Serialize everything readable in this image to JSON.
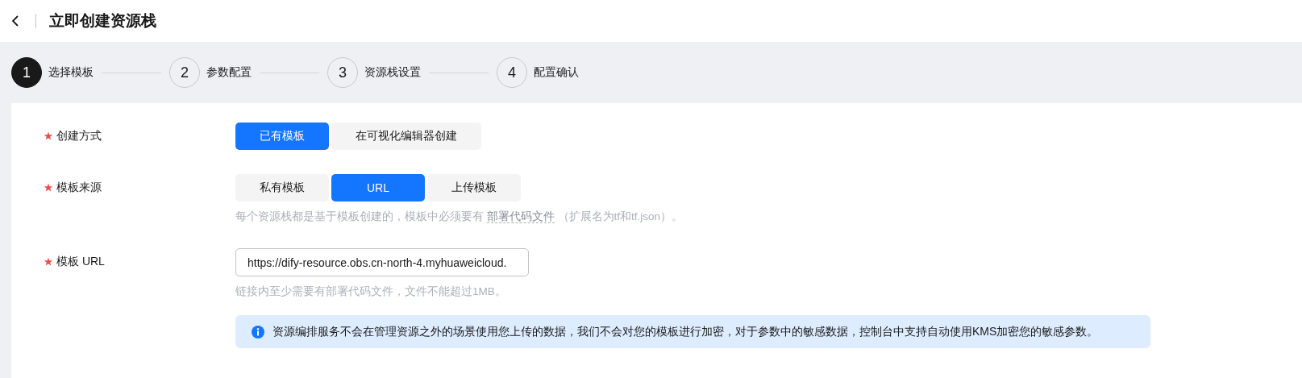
{
  "header": {
    "title": "立即创建资源栈"
  },
  "steps": [
    {
      "number": "1",
      "label": "选择模板",
      "selected": true
    },
    {
      "number": "2",
      "label": "参数配置",
      "selected": false
    },
    {
      "number": "3",
      "label": "资源栈设置",
      "selected": false
    },
    {
      "number": "4",
      "label": "配置确认",
      "selected": false
    }
  ],
  "form": {
    "fields": [
      {
        "kind": "segmented",
        "label": "创建方式",
        "required": true,
        "options": [
          {
            "label": "已有模板",
            "selected": true
          },
          {
            "label": "在可视化编辑器创建",
            "selected": false
          }
        ]
      },
      {
        "kind": "segmented",
        "label": "模板来源",
        "required": true,
        "options": [
          {
            "label": "私有模板",
            "selected": false
          },
          {
            "label": "URL",
            "selected": true
          },
          {
            "label": "上传模板",
            "selected": false
          }
        ],
        "hint": {
          "before": "每个资源栈都是基于模板创建的，模板中必须要有 ",
          "link": "部署代码文件",
          "after": " （扩展名为tf和tf.json）。"
        }
      },
      {
        "kind": "input",
        "label": "模板 URL",
        "required": true,
        "value": "https://dify-resource.obs.cn-north-4.myhuaweicloud.",
        "hint": {
          "before": "链接内至少需要有部署代码文件，文件不能超过1MB。"
        }
      }
    ],
    "notice": "资源编排服务不会在管理资源之外的场景使用您上传的数据，我们不会对您的模板进行加密，对于参数中的敏感数据，控制台中支持自动使用KMS加密您的敏感参数。"
  }
}
